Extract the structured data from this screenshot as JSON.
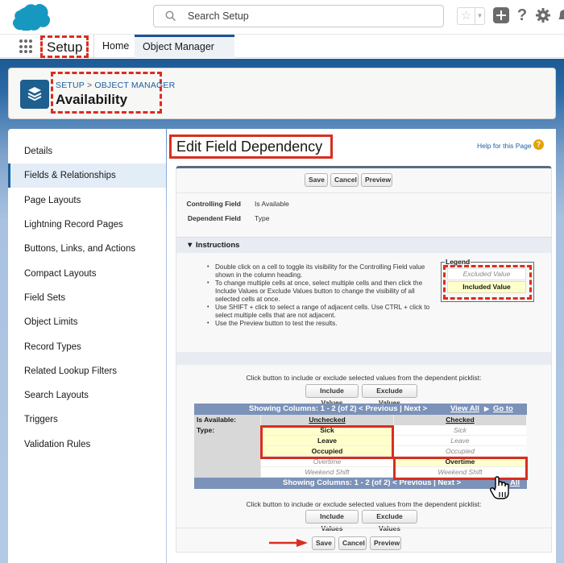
{
  "global_header": {
    "search_placeholder": "Search Setup",
    "icons": [
      "salesforce-cloud-logo",
      "search-icon",
      "favorites-star-icon",
      "favorites-dropdown-icon",
      "global-actions-plus-icon",
      "help-icon",
      "gear-icon",
      "notifications-bell-icon"
    ],
    "help_glyph": "?"
  },
  "nav": {
    "app_name": "Setup",
    "tabs": [
      {
        "label": "Home"
      },
      {
        "label": "Object Manager",
        "active": true
      }
    ],
    "chevron": "⌄"
  },
  "page_header": {
    "breadcrumb": [
      "SETUP",
      "OBJECT MANAGER"
    ],
    "breadcrumb_sep": ">",
    "title": "Availability"
  },
  "sidebar": {
    "items": [
      {
        "label": "Details"
      },
      {
        "label": "Fields & Relationships",
        "active": true
      },
      {
        "label": "Page Layouts"
      },
      {
        "label": "Lightning Record Pages"
      },
      {
        "label": "Buttons, Links, and Actions"
      },
      {
        "label": "Compact Layouts"
      },
      {
        "label": "Field Sets"
      },
      {
        "label": "Object Limits"
      },
      {
        "label": "Record Types"
      },
      {
        "label": "Related Lookup Filters"
      },
      {
        "label": "Search Layouts"
      },
      {
        "label": "Triggers"
      },
      {
        "label": "Validation Rules"
      }
    ]
  },
  "main": {
    "title": "Edit Field Dependency",
    "help_link": "Help for this Page",
    "help_badge": "?",
    "buttons": {
      "save": "Save",
      "cancel": "Cancel",
      "preview": "Preview"
    },
    "controlling_field_label": "Controlling Field",
    "controlling_field_value": "Is Available",
    "dependent_field_label": "Dependent Field",
    "dependent_field_value": "Type",
    "instructions_header": "▼ Instructions",
    "instructions": [
      "Double click on a cell to toggle its visibility for the Controlling Field value shown in the column heading.",
      "To change multiple cells at once, select multiple cells and then click the Include Values or Exclude Values button to change the visibility of all selected cells at once.",
      "Use SHIFT + click to select a range of adjacent cells. Use CTRL + click to select multiple cells that are not adjacent.",
      "Use the Preview button to test the results."
    ],
    "legend": {
      "title": "Legend",
      "excluded": "Excluded Value",
      "included": "Included Value"
    },
    "click_text": "Click button to include or exclude selected values from the dependent picklist:",
    "include_values": "Include Values",
    "exclude_values": "Exclude Values",
    "matrix": {
      "pager_text": "Showing Columns: 1 - 2 (of 2) < Previous | Next >",
      "view_all": "View All",
      "go_to": "Go to",
      "view_all_short": "All",
      "controlling_label": "Is Available:",
      "dependent_label": "Type:",
      "columns": [
        "Unchecked",
        "Checked"
      ],
      "rows": [
        {
          "value": "Sick",
          "included": [
            true,
            false
          ]
        },
        {
          "value": "Leave",
          "included": [
            true,
            false
          ]
        },
        {
          "value": "Occupied",
          "included": [
            true,
            false
          ]
        },
        {
          "value": "Overtime",
          "included": [
            false,
            true
          ]
        },
        {
          "value": "Weekend Shift",
          "included": [
            false,
            false
          ]
        }
      ]
    }
  }
}
